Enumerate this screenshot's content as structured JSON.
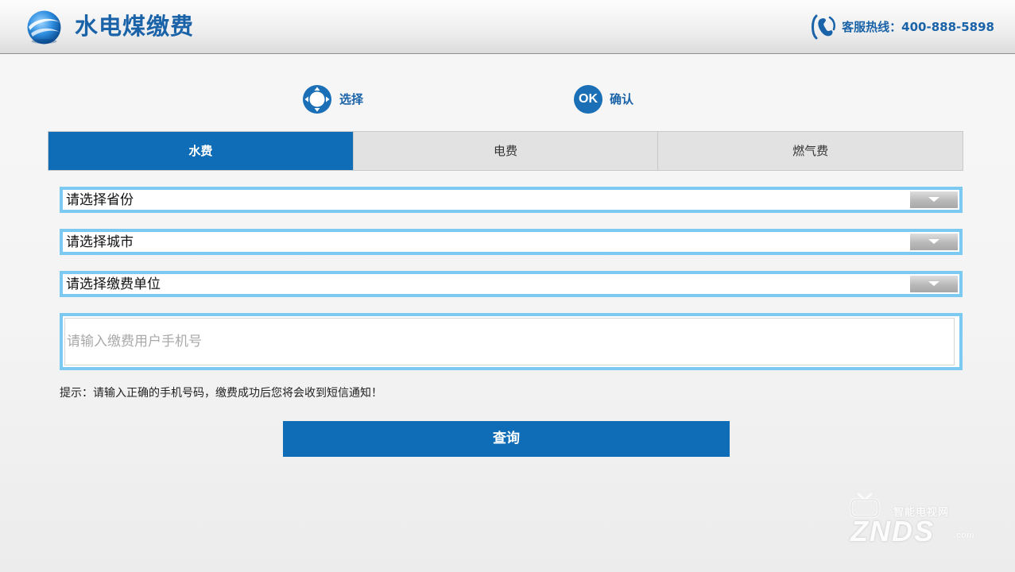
{
  "header": {
    "title": "水电煤缴费",
    "hotline": "客服热线：400-888-5898"
  },
  "hints": {
    "select_label": "选择",
    "confirm_icon_text": "OK",
    "confirm_label": "确认"
  },
  "tabs": [
    {
      "label": "水费",
      "active": true
    },
    {
      "label": "电费",
      "active": false
    },
    {
      "label": "燃气费",
      "active": false
    }
  ],
  "form": {
    "province": "请选择省份",
    "city": "请选择城市",
    "unit": "请选择缴费单位",
    "phone_value": "",
    "phone_placeholder": "请输入缴费用户手机号"
  },
  "tip": "提示：请输入正确的手机号码，缴费成功后您将会收到短信通知！",
  "query_button": "查询",
  "watermark": {
    "top_text": "智能电视网",
    "main_text": "ZNDS",
    "suffix": ".com"
  },
  "colors": {
    "accent": "#0f6db7",
    "brand_text": "#1a63a8",
    "field_border": "#7ccaf2",
    "tab_inactive": "#e2e2e2"
  }
}
